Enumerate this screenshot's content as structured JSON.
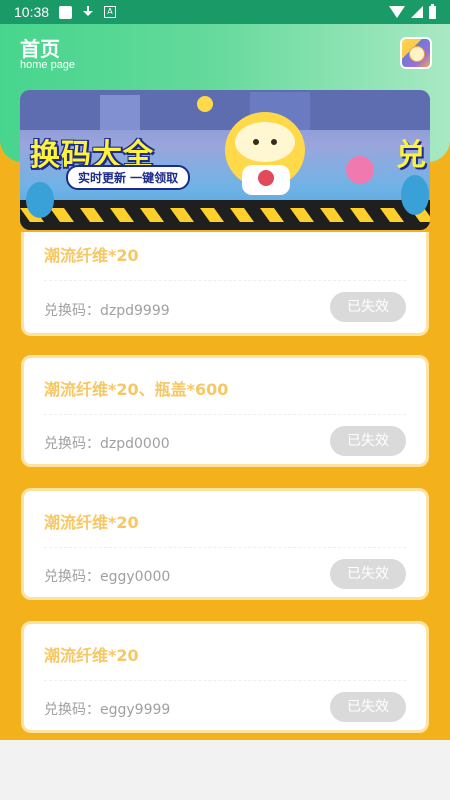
{
  "status_bar": {
    "time": "10:38"
  },
  "header": {
    "title": "首页",
    "subtitle": "home page",
    "avatar_icon": "app-avatar-icon"
  },
  "banner": {
    "title": "换码大全",
    "tag": "实时更新 一键领取",
    "right_text": "兑"
  },
  "cards": [
    {
      "title": "潮流纤维*20",
      "code_label": "兑换码：",
      "code": "dzpd9999",
      "button_label": "已失效"
    },
    {
      "title": "潮流纤维*20、瓶盖*600",
      "code_label": "兑换码：",
      "code": "dzpd0000",
      "button_label": "已失效"
    },
    {
      "title": "潮流纤维*20",
      "code_label": "兑换码：",
      "code": "eggy0000",
      "button_label": "已失效"
    },
    {
      "title": "潮流纤维*20",
      "code_label": "兑换码：",
      "code": "eggy9999",
      "button_label": "已失效"
    }
  ],
  "colors": {
    "background": "#f3b21c",
    "header_green": "#47d58d",
    "card_title": "#f7c763",
    "button_disabled": "#dadada"
  }
}
